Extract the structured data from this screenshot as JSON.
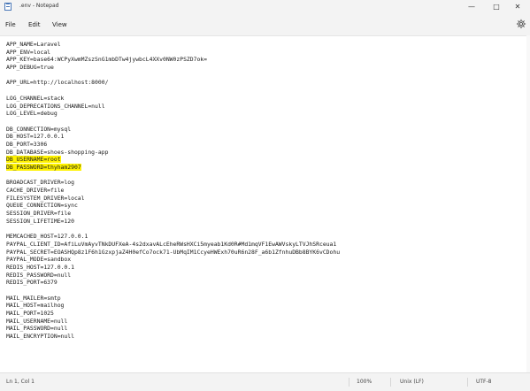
{
  "window": {
    "title": ".env - Notepad",
    "minimize_glyph": "—",
    "maximize_glyph": "□",
    "close_glyph": "✕"
  },
  "menu": {
    "file": "File",
    "edit": "Edit",
    "view": "View"
  },
  "icons": {
    "app": "notepad-icon",
    "settings": "gear-icon"
  },
  "colors": {
    "highlight": "#fff200",
    "chrome": "#f3f3f3",
    "editor_bg": "#ffffff"
  },
  "editor": {
    "lines": [
      "APP_NAME=Laravel",
      "APP_ENV=local",
      "APP_KEY=base64:WCPyXwmMZszSnG1mbDTw4jywbcL4XXv0NW0zPSZD7ok=",
      "APP_DEBUG=true",
      "",
      "APP_URL=http://localhost:8000/",
      "",
      "LOG_CHANNEL=stack",
      "LOG_DEPRECATIONS_CHANNEL=null",
      "LOG_LEVEL=debug",
      "",
      "DB_CONNECTION=mysql",
      "DB_HOST=127.0.0.1",
      "DB_PORT=3306",
      "DB_DATABASE=shoes-shopping-app",
      "DB_USERNAME=root",
      "DB_PASSWORD=thyham2907",
      "",
      "BROADCAST_DRIVER=log",
      "CACHE_DRIVER=file",
      "FILESYSTEM_DRIVER=local",
      "QUEUE_CONNECTION=sync",
      "SESSION_DRIVER=file",
      "SESSION_LIFETIME=120",
      "",
      "MEMCACHED_HOST=127.0.0.1",
      "PAYPAL_CLIENT_ID=AfiLuVmAyvTNkDUFXeA-4s2dxavALcEheRWsHXCi5myeab1Kd0R#Md1mqVF1EwAWVskyLTVJhSRceua1",
      "PAYPAL_SECRET=EOASHQp8z1F6h1GzxpjaZ4H0efCo7ock71-UbMqIM1CcyeHWExh70uR6n28F_a6b1ZfnhuDBb8BYK6vCDohu",
      "PAYPAL_MODE=sandbox",
      "REDIS_HOST=127.0.0.1",
      "REDIS_PASSWORD=null",
      "REDIS_PORT=6379",
      "",
      "MAIL_MAILER=smtp",
      "MAIL_HOST=mailhog",
      "MAIL_PORT=1025",
      "MAIL_USERNAME=null",
      "MAIL_PASSWORD=null",
      "MAIL_ENCRYPTION=null"
    ],
    "highlighted_lines": [
      15,
      16
    ]
  },
  "status": {
    "position": "Ln 1, Col 1",
    "zoom": "100%",
    "line_ending": "Unix (LF)",
    "encoding": "UTF-8"
  }
}
